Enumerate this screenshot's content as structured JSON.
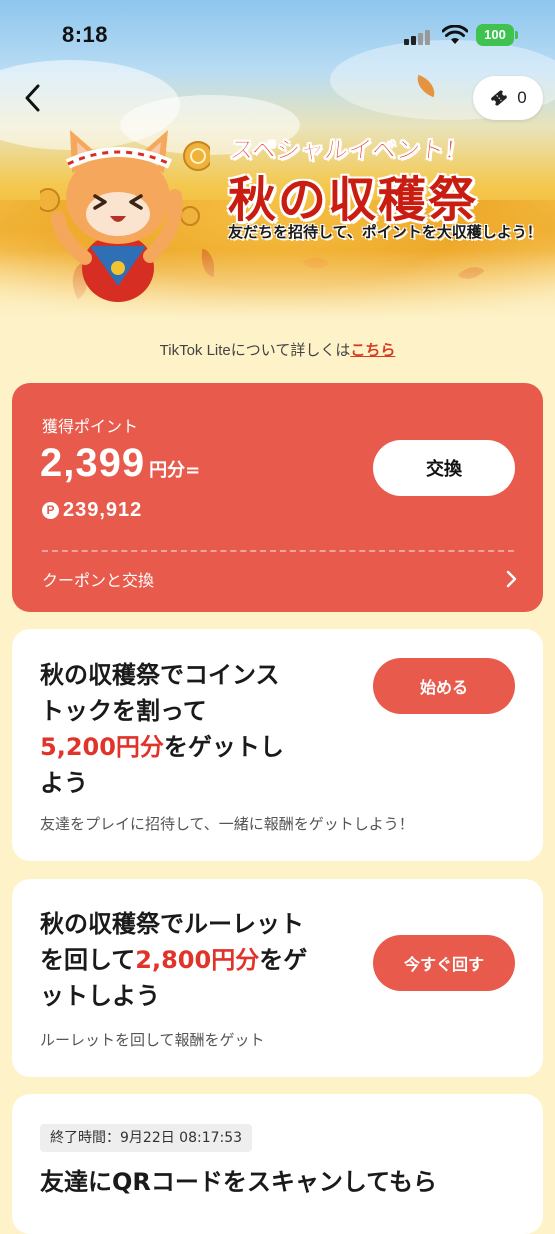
{
  "status_bar": {
    "time": "8:18",
    "battery": "100"
  },
  "nav": {
    "ticket_count": "0"
  },
  "hero": {
    "subtitle": "スペシャルイベント！",
    "title": "秋の収穫祭",
    "tagline": "友だちを招待して、ポイントを大収穫しよう！"
  },
  "info": {
    "prefix": "TikTok Liteについて詳しくは",
    "link": "こちら"
  },
  "points": {
    "label": "獲得ポイント",
    "amount": "2,399",
    "unit": "円分=",
    "coin_symbol": "P",
    "coins": "239,912",
    "exchange_label": "交換",
    "coupon_label": "クーポンと交換"
  },
  "tasks": [
    {
      "title_line1": "秋の収穫祭でコインス",
      "title_line2": "トックを割って",
      "title_highlight": "5,200円分",
      "title_line3_rest": "をゲットし",
      "title_line4": "よう",
      "description": "友達をプレイに招待して、一緒に報酬をゲットしよう！",
      "button": "始める"
    },
    {
      "title_line1": "秋の収穫祭でルーレット",
      "title_line2_pre": "を回して",
      "title_highlight": "2,800円分",
      "title_line2_post": "をゲ",
      "title_line3": "ットしよう",
      "description": "ルーレットを回して報酬をゲット",
      "button": "今すぐ回す"
    },
    {
      "deadline": "終了時間：9月22日 08:17:53",
      "title_line1": "友達にQRコードをスキャンしてもら"
    }
  ],
  "colors": {
    "accent": "#e85a4c",
    "highlight": "#e0332a",
    "background": "#fdf2c8"
  }
}
